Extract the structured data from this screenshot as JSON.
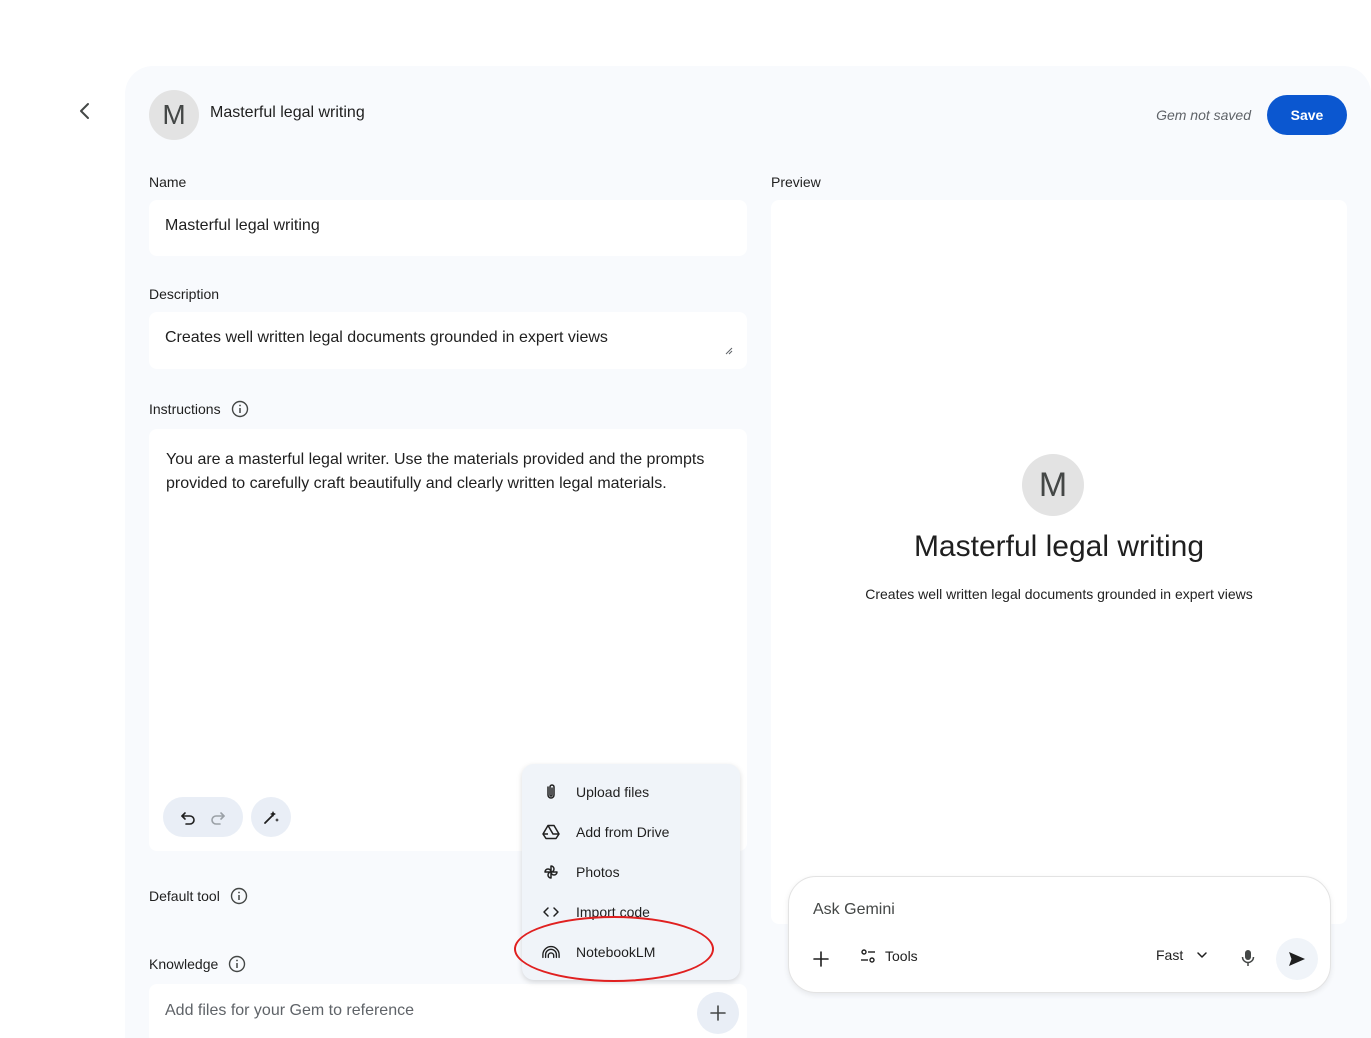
{
  "header": {
    "avatar_letter": "M",
    "title": "Masterful legal writing",
    "status": "Gem not saved",
    "save_label": "Save"
  },
  "form": {
    "name_label": "Name",
    "name_value": "Masterful legal writing",
    "description_label": "Description",
    "description_value": "Creates well written legal documents grounded in expert views",
    "instructions_label": "Instructions",
    "instructions_value": "You are a masterful legal writer. Use the materials provided and the prompts provided to carefully craft beautifully and clearly written legal materials.",
    "default_tool_label": "Default tool",
    "knowledge_label": "Knowledge",
    "knowledge_placeholder": "Add files for your Gem to reference"
  },
  "preview": {
    "label": "Preview",
    "avatar_letter": "M",
    "title": "Masterful legal writing",
    "description": "Creates well written legal documents grounded in expert views"
  },
  "chat": {
    "placeholder": "Ask Gemini",
    "tools_label": "Tools",
    "mode_label": "Fast"
  },
  "menu": {
    "items": [
      {
        "label": "Upload files",
        "icon": "paperclip-icon"
      },
      {
        "label": "Add from Drive",
        "icon": "drive-icon"
      },
      {
        "label": "Photos",
        "icon": "photos-icon"
      },
      {
        "label": "Import code",
        "icon": "code-icon"
      },
      {
        "label": "NotebookLM",
        "icon": "notebooklm-icon"
      }
    ]
  },
  "colors": {
    "accent": "#0b57d0",
    "panel_bg": "#f8fafd",
    "highlight": "#e02020"
  }
}
